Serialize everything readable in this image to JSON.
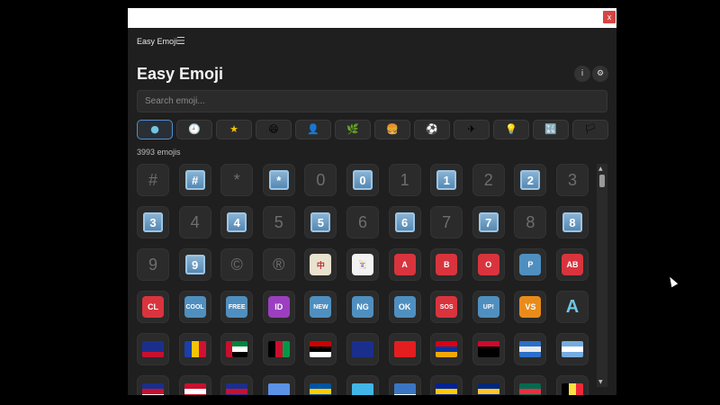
{
  "window": {
    "close_label": "x"
  },
  "appbar": {
    "title": "Easy Emoji",
    "menu_icon": "☰"
  },
  "header": {
    "title": "Easy Emoji",
    "info_label": "i",
    "settings_label": "⚙"
  },
  "search": {
    "placeholder": "Search emoji..."
  },
  "categories": [
    {
      "name": "all",
      "icon": "●"
    },
    {
      "name": "recent",
      "icon": "🕘"
    },
    {
      "name": "favorites",
      "icon": "★"
    },
    {
      "name": "smileys",
      "icon": "😄"
    },
    {
      "name": "people",
      "icon": "👤"
    },
    {
      "name": "nature",
      "icon": "🌿"
    },
    {
      "name": "food",
      "icon": "🍔"
    },
    {
      "name": "activities",
      "icon": "⚽"
    },
    {
      "name": "travel",
      "icon": "✈"
    },
    {
      "name": "objects",
      "icon": "💡"
    },
    {
      "name": "symbols",
      "icon": "🔣"
    },
    {
      "name": "flags",
      "icon": "🏳"
    }
  ],
  "count": {
    "text": "3993 emojis"
  },
  "emojis": [
    {
      "t": "plain",
      "v": "#"
    },
    {
      "t": "key",
      "v": "#"
    },
    {
      "t": "plain",
      "v": "*"
    },
    {
      "t": "key",
      "v": "*"
    },
    {
      "t": "plain",
      "v": "0"
    },
    {
      "t": "key",
      "v": "0"
    },
    {
      "t": "plain",
      "v": "1"
    },
    {
      "t": "key",
      "v": "1"
    },
    {
      "t": "plain",
      "v": "2"
    },
    {
      "t": "key",
      "v": "2"
    },
    {
      "t": "plain",
      "v": "3"
    },
    {
      "t": "key",
      "v": "3"
    },
    {
      "t": "plain",
      "v": "4"
    },
    {
      "t": "key",
      "v": "4"
    },
    {
      "t": "plain",
      "v": "5"
    },
    {
      "t": "key",
      "v": "5"
    },
    {
      "t": "plain",
      "v": "6"
    },
    {
      "t": "key",
      "v": "6"
    },
    {
      "t": "plain",
      "v": "7"
    },
    {
      "t": "key",
      "v": "7"
    },
    {
      "t": "plain",
      "v": "8"
    },
    {
      "t": "key",
      "v": "8"
    },
    {
      "t": "plain",
      "v": "9"
    },
    {
      "t": "key",
      "v": "9"
    },
    {
      "t": "plain",
      "v": "©"
    },
    {
      "t": "plain",
      "v": "®"
    },
    {
      "t": "sq",
      "v": "中",
      "c": "#e9e2cf",
      "fg": "#b33"
    },
    {
      "t": "sq",
      "v": "🃏",
      "c": "#f2f2f2",
      "fg": "#333"
    },
    {
      "t": "sq",
      "v": "A",
      "c": "#d9343d",
      "fg": "#fff"
    },
    {
      "t": "sq",
      "v": "B",
      "c": "#d9343d",
      "fg": "#fff"
    },
    {
      "t": "sq",
      "v": "O",
      "c": "#d9343d",
      "fg": "#fff"
    },
    {
      "t": "sq",
      "v": "P",
      "c": "#4f8fc0",
      "fg": "#fff"
    },
    {
      "t": "sq",
      "v": "AB",
      "c": "#d9343d",
      "fg": "#fff"
    },
    {
      "t": "sq",
      "v": "CL",
      "c": "#d9343d",
      "fg": "#fff"
    },
    {
      "t": "sq",
      "v": "COOL",
      "c": "#4f8fc0",
      "fg": "#fff"
    },
    {
      "t": "sq",
      "v": "FREE",
      "c": "#4f8fc0",
      "fg": "#fff"
    },
    {
      "t": "sq",
      "v": "ID",
      "c": "#9b3fc0",
      "fg": "#fff"
    },
    {
      "t": "sq",
      "v": "NEW",
      "c": "#4f8fc0",
      "fg": "#fff"
    },
    {
      "t": "sq",
      "v": "NG",
      "c": "#4f8fc0",
      "fg": "#fff"
    },
    {
      "t": "sq",
      "v": "OK",
      "c": "#4f8fc0",
      "fg": "#fff"
    },
    {
      "t": "sq",
      "v": "SOS",
      "c": "#d9343d",
      "fg": "#fff"
    },
    {
      "t": "sq",
      "v": "UP!",
      "c": "#4f8fc0",
      "fg": "#fff"
    },
    {
      "t": "sq",
      "v": "VS",
      "c": "#e98b1b",
      "fg": "#fff"
    },
    {
      "t": "sq",
      "v": "A",
      "c": "transparent",
      "fg": "#6fc6e6"
    },
    {
      "t": "flag",
      "f": [
        "#1a2f8c",
        "#1a2f8c",
        "#c8102e"
      ]
    },
    {
      "t": "flag",
      "f": [
        "#1a3fa8",
        "#f5c400",
        "#d21034"
      ],
      "dir": "v"
    },
    {
      "t": "flag",
      "f": [
        "#00843d",
        "#ffffff",
        "#000000"
      ],
      "side": "#c8102e"
    },
    {
      "t": "flag",
      "f": [
        "#000000",
        "#c8102e",
        "#009a44"
      ],
      "dir": "v"
    },
    {
      "t": "flag",
      "f": [
        "#cc0000",
        "#000000",
        "#ffffff"
      ]
    },
    {
      "t": "flag",
      "f": [
        "#1a2f8c",
        "#1a2f8c",
        "#1a2f8c"
      ]
    },
    {
      "t": "flag",
      "f": [
        "#e41e20",
        "#e41e20",
        "#e41e20"
      ]
    },
    {
      "t": "flag",
      "f": [
        "#d90012",
        "#0033a0",
        "#f2a800"
      ]
    },
    {
      "t": "flag",
      "f": [
        "#cc092f",
        "#000000",
        "#000000"
      ]
    },
    {
      "t": "flag",
      "f": [
        "#2a6fc9",
        "#eaeaea",
        "#2a6fc9"
      ]
    },
    {
      "t": "flag",
      "f": [
        "#74acdf",
        "#ffffff",
        "#74acdf"
      ]
    },
    {
      "t": "flag",
      "f": [
        "#1a2f8c",
        "#c8102e",
        "#ffffff"
      ]
    },
    {
      "t": "flag",
      "f": [
        "#c8102e",
        "#ffffff",
        "#c8102e"
      ]
    },
    {
      "t": "flag",
      "f": [
        "#1a2f8c",
        "#c8102e",
        "#1a2f8c"
      ]
    },
    {
      "t": "flag",
      "f": [
        "#5b92e5",
        "#5b92e5",
        "#5b92e5"
      ]
    },
    {
      "t": "flag",
      "f": [
        "#0053a5",
        "#ffce00",
        "#0053a5"
      ]
    },
    {
      "t": "flag",
      "f": [
        "#41b6e6",
        "#41b6e6",
        "#41b6e6"
      ]
    },
    {
      "t": "flag",
      "f": [
        "#3a75c4",
        "#3a75c4",
        "#ffffff"
      ]
    },
    {
      "t": "flag",
      "f": [
        "#002395",
        "#fecb00",
        "#002395"
      ]
    },
    {
      "t": "flag",
      "f": [
        "#00267f",
        "#ffc726",
        "#00267f"
      ]
    },
    {
      "t": "flag",
      "f": [
        "#006a4e",
        "#f42a41",
        "#006a4e"
      ]
    },
    {
      "t": "flag",
      "f": [
        "#000000",
        "#fae042",
        "#ed2939"
      ],
      "dir": "v"
    }
  ]
}
